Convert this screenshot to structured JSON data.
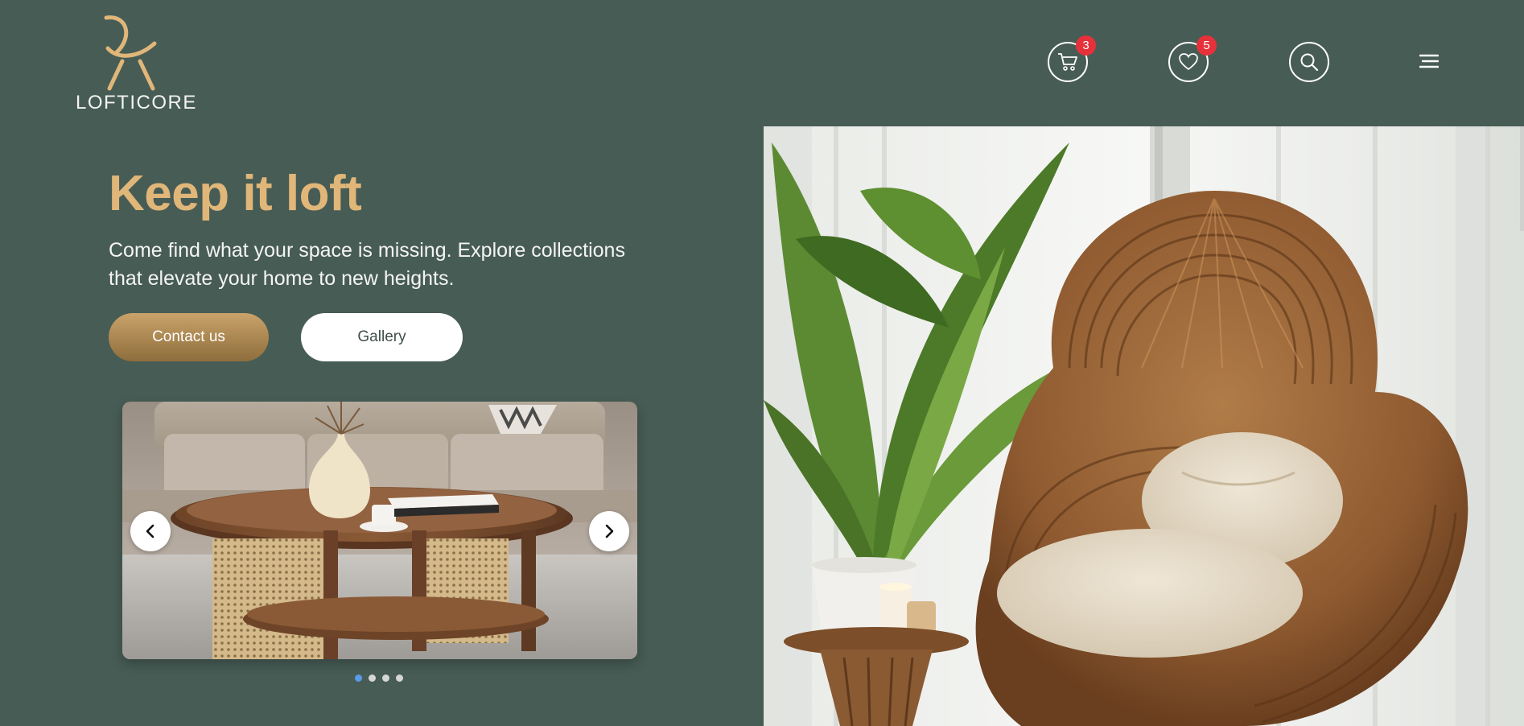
{
  "brand": {
    "name": "LOFTICORE",
    "logo_color": "#e0b679"
  },
  "header": {
    "cart": {
      "icon": "cart-icon",
      "count": "3"
    },
    "wishlist": {
      "icon": "heart-icon",
      "count": "5"
    },
    "search": {
      "icon": "search-icon"
    },
    "menu": {
      "icon": "hamburger-menu-icon"
    }
  },
  "hero": {
    "title": "Keep it loft",
    "subtitle": "Come find what your space is missing. Explore collections that elevate your home to new heights.",
    "contact_label": "Contact us",
    "gallery_label": "Gallery",
    "title_color": "#e0b679",
    "background_color": "#475c55"
  },
  "carousel": {
    "total_slides": 4,
    "active_slide": 1,
    "prev_icon": "chevron-left-icon",
    "next_icon": "chevron-right-icon"
  },
  "hero_image": {
    "subject": "rattan lounge chair with plant"
  }
}
